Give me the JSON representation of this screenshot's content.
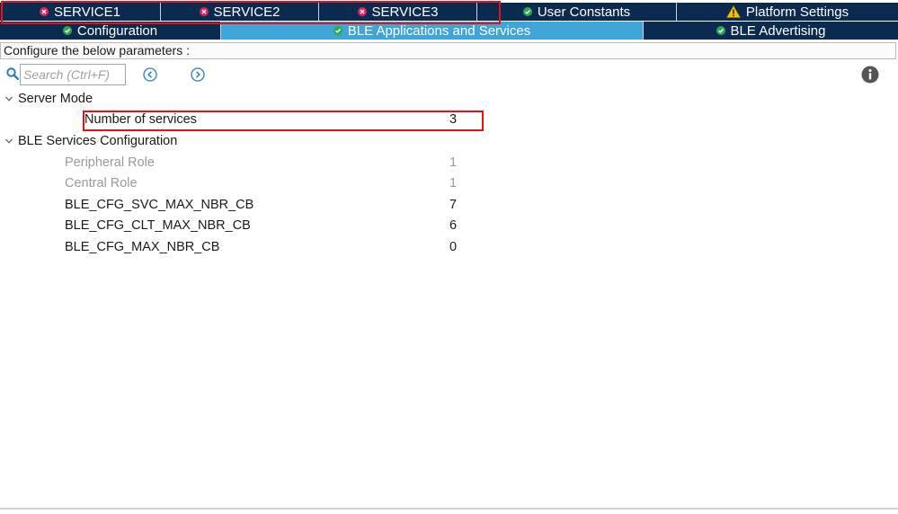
{
  "tabs_row1": [
    {
      "label": "SERVICE1",
      "status": "error"
    },
    {
      "label": "SERVICE2",
      "status": "error"
    },
    {
      "label": "SERVICE3",
      "status": "error"
    },
    {
      "label": "User Constants",
      "status": "ok"
    },
    {
      "label": "Platform Settings",
      "status": "warning"
    }
  ],
  "tabs_row2": [
    {
      "label": "Configuration",
      "status": "ok"
    },
    {
      "label": "BLE Applications and Services",
      "status": "ok",
      "active": true
    },
    {
      "label": "BLE Advertising",
      "status": "ok"
    }
  ],
  "config_title": "Configure the below parameters :",
  "search": {
    "placeholder": "Search (Ctrl+F)"
  },
  "groups": {
    "server_mode": {
      "label": "Server Mode",
      "params": [
        {
          "label": "Number of services",
          "value": "3"
        }
      ]
    },
    "ble_services": {
      "label": "BLE Services Configuration",
      "params": [
        {
          "label": "Peripheral Role",
          "value": "1",
          "disabled": true
        },
        {
          "label": "Central Role",
          "value": "1",
          "disabled": true
        },
        {
          "label": "BLE_CFG_SVC_MAX_NBR_CB",
          "value": "7"
        },
        {
          "label": "BLE_CFG_CLT_MAX_NBR_CB",
          "value": "6"
        },
        {
          "label": "BLE_CFG_MAX_NBR_CB",
          "value": "0"
        }
      ]
    }
  },
  "colors": {
    "tab_bg": "#0b2a4f",
    "tab_active": "#3fa5d9",
    "error_icon": "#e0245e",
    "ok_icon": "#2fa84f",
    "warning_icon": "#f2c200",
    "highlight_box": "#e0131b"
  },
  "icons": {
    "error": "error-circle-icon",
    "ok": "check-circle-icon",
    "warning": "warning-triangle-icon",
    "search": "search-icon",
    "prev": "chevron-left-circle-icon",
    "next": "chevron-right-circle-icon",
    "info": "info-icon",
    "expand": "chevron-down-icon"
  }
}
